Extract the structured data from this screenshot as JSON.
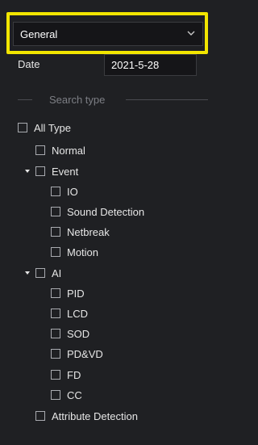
{
  "general_select": {
    "value": "General",
    "icon": "chevron-down-icon"
  },
  "date": {
    "label": "Date",
    "value": "2021-5-28"
  },
  "search_type": {
    "title": "Search type"
  },
  "tree": {
    "all_type": "All Type",
    "normal": "Normal",
    "event": "Event",
    "io": "IO",
    "sound_detection": "Sound Detection",
    "netbreak": "Netbreak",
    "motion": "Motion",
    "ai": "AI",
    "pid": "PID",
    "lcd": "LCD",
    "sod": "SOD",
    "pdvd": "PD&VD",
    "fd": "FD",
    "cc": "CC",
    "attribute_detection": "Attribute Detection"
  },
  "colors": {
    "highlight": "#f2e500",
    "background": "#1f2023"
  }
}
